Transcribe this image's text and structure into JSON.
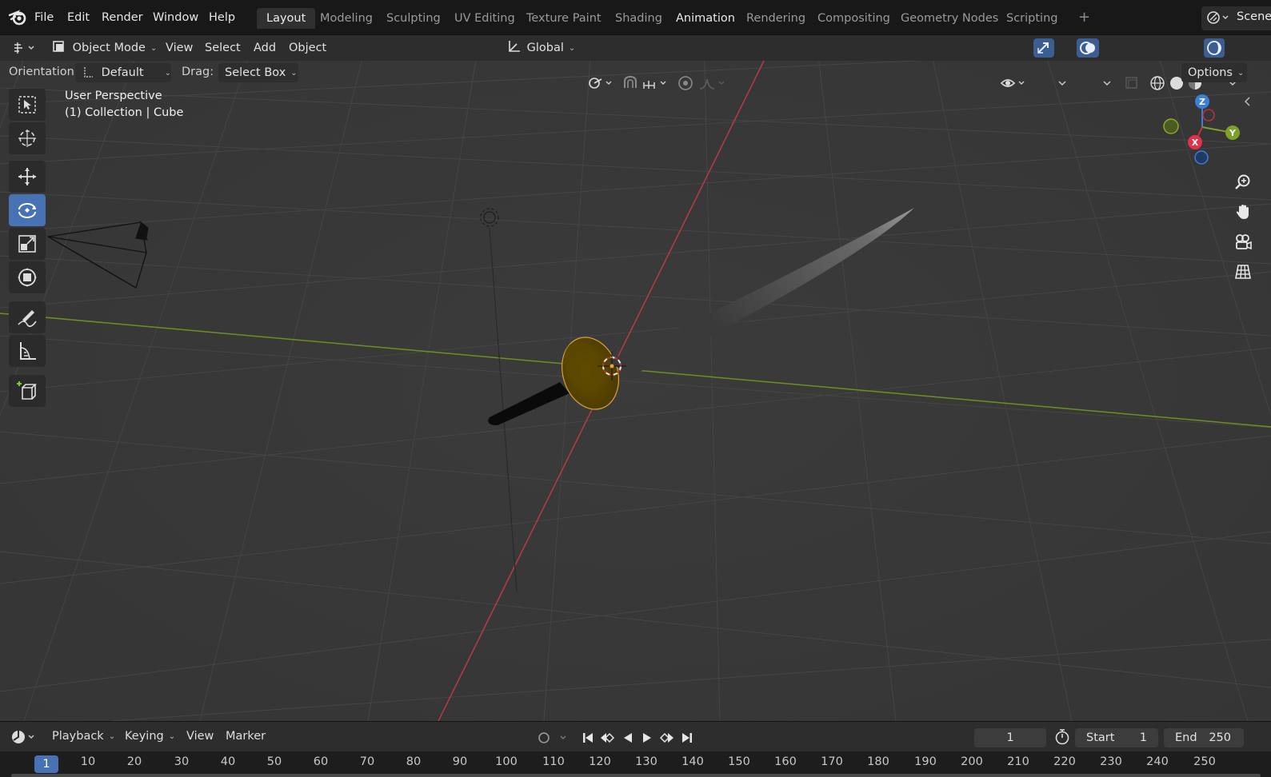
{
  "topbar": {
    "menus": [
      "File",
      "Edit",
      "Render",
      "Window",
      "Help"
    ],
    "workspaces": [
      {
        "label": "Layout",
        "active": true
      },
      {
        "label": "Modeling"
      },
      {
        "label": "Sculpting"
      },
      {
        "label": "UV Editing"
      },
      {
        "label": "Texture Paint"
      },
      {
        "label": "Shading"
      },
      {
        "label": "Animation"
      },
      {
        "label": "Rendering"
      },
      {
        "label": "Compositing"
      },
      {
        "label": "Geometry Nodes"
      },
      {
        "label": "Scripting"
      }
    ],
    "add_workspace": "+",
    "scene": "Scene"
  },
  "header": {
    "mode": "Object Mode",
    "menus": [
      "View",
      "Select",
      "Add",
      "Object"
    ],
    "transform_orientation": "Global"
  },
  "tool_settings": {
    "orientation_label": "Orientation:",
    "orientation_value": "Default",
    "drag_label": "Drag:",
    "drag_value": "Select Box",
    "options": "Options"
  },
  "viewport": {
    "view_name": "User Perspective",
    "collection": "(1) Collection | Cube",
    "gizmo": {
      "z": "Z",
      "y": "Y",
      "x": "X"
    }
  },
  "toolbar": {
    "tools": [
      "select-box",
      "cursor",
      "move",
      "rotate",
      "scale",
      "transform",
      "annotate",
      "measure",
      "add-cube"
    ],
    "active_tool": "rotate"
  },
  "timeline": {
    "menus": [
      "Playback",
      "Keying",
      "View",
      "Marker"
    ],
    "current_frame": "1",
    "start_label": "Start",
    "start_value": "1",
    "end_label": "End",
    "end_value": "250",
    "ruler_current": "1",
    "ruler_ticks": [
      "10",
      "20",
      "30",
      "40",
      "50",
      "60",
      "70",
      "80",
      "90",
      "100",
      "110",
      "120",
      "130",
      "140",
      "150",
      "160",
      "170",
      "180",
      "190",
      "200",
      "210",
      "220",
      "230",
      "240",
      "250"
    ]
  },
  "colors": {
    "x_axis": "#c8323c",
    "y_axis": "#7ea02a",
    "z_axis": "#3b7fd6",
    "active_blue": "#4772b3",
    "selection_orange": "#e8a23a"
  }
}
